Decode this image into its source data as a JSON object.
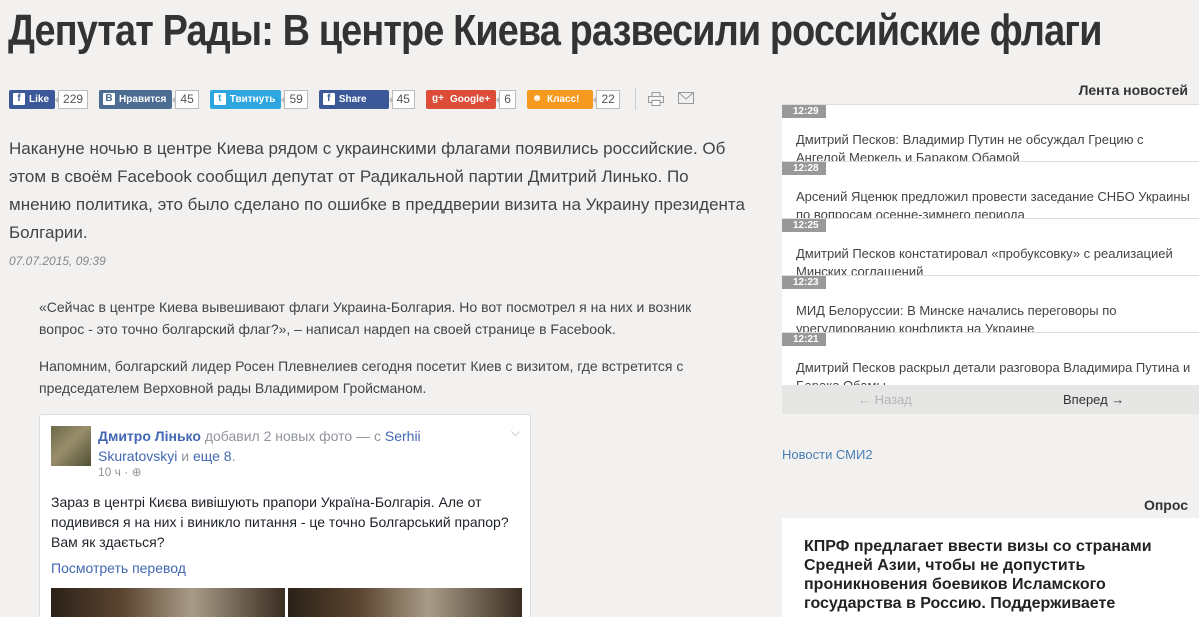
{
  "article": {
    "headline": "Депутат Рады: В центре Киева развесили российские флаги",
    "lead": "Накануне ночью в центре Киева рядом с украинскими флагами появились российские. Об этом в своём Facebook сообщил депутат от Радикальной партии Дмитрий Линько. По мнению политика, это было сделано по ошибке в преддверии визита на Украину президента Болгарии.",
    "date": "07.07.2015, 09:39",
    "quote": "«Сейчас в центре Киева вывешивают флаги Украина-Болгария. Но вот посмотрел я на них и возник вопрос - это точно болгарский флаг?», – написал нардеп на своей странице в Facebook.",
    "reminder": "Напомним, болгарский лидер Росен Плевнелиев сегодня посетит Киев с визитом, где встретится с председателем Верховной рады Владимиром Гройсманом."
  },
  "share": {
    "buttons": [
      {
        "label": "Like",
        "icon": "f",
        "count": "229",
        "color": "#3b5998",
        "name": "facebook-like"
      },
      {
        "label": "Нравится",
        "icon": "B",
        "count": "45",
        "color": "#4c6c91",
        "name": "vk-like"
      },
      {
        "label": "Твитнуть",
        "icon": "t",
        "count": "59",
        "color": "#2ea7e0",
        "name": "twitter-tweet"
      },
      {
        "label": "Share",
        "icon": "f",
        "count": "45",
        "color": "#3b5998",
        "name": "facebook-share"
      },
      {
        "label": "Google+",
        "icon": "g+",
        "count": "6",
        "color": "#dd4b39",
        "name": "google-plus"
      },
      {
        "label": "Класс!",
        "icon": "ok",
        "count": "22",
        "color": "#f59a1f",
        "name": "odnoklassniki"
      }
    ],
    "print_icon": "print-icon",
    "mail_icon": "mail-icon"
  },
  "fb_post": {
    "author": "Дмитро Лінько",
    "action": " добавил 2 новых фото — с ",
    "tagged": "Serhii Skuratovskyi",
    "and": " и ",
    "others": "еще 8",
    "period": ".",
    "time": "10 ч · ⊕",
    "text": "Зараз в центрі Києва вивішують прапори Україна-Болгарія. Але от подивився я на них і виникло питання - це точно Болгарський прапор? Вам як здається?",
    "translate": "Посмотреть перевод"
  },
  "sidebar": {
    "news_title": "Лента новостей",
    "news": [
      {
        "time": "12:29",
        "text": "Дмитрий Песков: Владимир Путин не обсуждал Грецию с Ангелой Меркель и Бараком Обамой"
      },
      {
        "time": "12:28",
        "text": "Арсений Яценюк предложил провести заседание СНБО Украины по вопросам осенне-зимнего периода"
      },
      {
        "time": "12:25",
        "text": "Дмитрий Песков констатировал «пробуксовку» с реализацией Минских соглашений"
      },
      {
        "time": "12:23",
        "text": "МИД Белоруссии: В Минске начались переговоры по урегулированию конфликта на Украине"
      },
      {
        "time": "12:21",
        "text": "Дмитрий Песков раскрыл детали разговора Владимира Путина и Барака Обамы"
      }
    ],
    "nav_back": "← Назад",
    "nav_forward": "Вперед →",
    "smi2_link": "Новости СМИ2",
    "poll_title": "Опрос",
    "poll_question": "КПРФ предлагает ввести визы со странами Средней Азии, чтобы не допустить проникновения боевиков Исламского государства в Россию. Поддерживаете"
  }
}
